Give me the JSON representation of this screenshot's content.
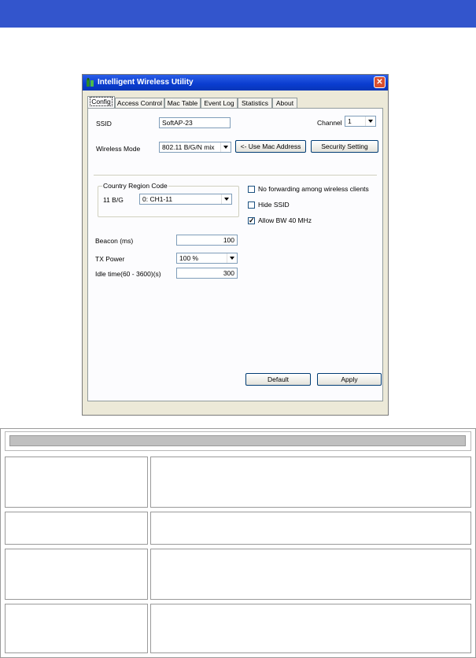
{
  "window": {
    "title": "Intelligent Wireless Utility",
    "close_symbol": "✕"
  },
  "tabs": [
    {
      "label": "Config",
      "active": true
    },
    {
      "label": "Access Control",
      "active": false
    },
    {
      "label": "Mac Table",
      "active": false
    },
    {
      "label": "Event Log",
      "active": false
    },
    {
      "label": "Statistics",
      "active": false
    },
    {
      "label": "About",
      "active": false
    }
  ],
  "config": {
    "ssid_label": "SSID",
    "ssid_value": "SoftAP-23",
    "channel_label": "Channel",
    "channel_value": "1",
    "wireless_mode_label": "Wireless Mode",
    "wireless_mode_value": "802.11 B/G/N mix",
    "use_mac_button": "<- Use Mac Address",
    "security_button": "Security Setting",
    "country_group_title": "Country Region Code",
    "band_label": "11 B/G",
    "region_value": "0: CH1-11",
    "no_forwarding_label": "No forwarding among wireless clients",
    "no_forwarding_checked": false,
    "hide_ssid_label": "Hide SSID",
    "hide_ssid_checked": false,
    "allow_bw_label": "Allow BW 40 MHz",
    "allow_bw_checked": true,
    "check_mark": "✓",
    "beacon_label": "Beacon (ms)",
    "beacon_value": "100",
    "tx_power_label": "TX Power",
    "tx_power_value": "100 %",
    "idle_label": "Idle time(60 - 3600)(s)",
    "idle_value": "300",
    "default_button": "Default",
    "apply_button": "Apply"
  },
  "colors": {
    "top_bar": "#3355cc",
    "title_bar": "#0a3ccf",
    "dialog_bg": "#ece9d8"
  }
}
